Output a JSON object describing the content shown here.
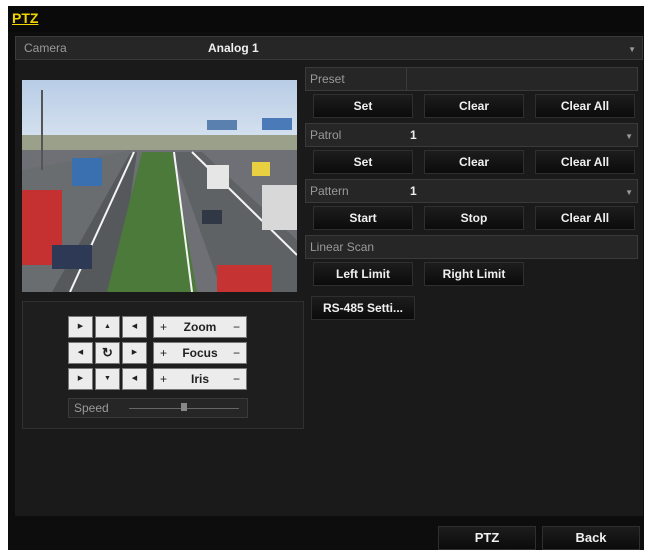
{
  "window": {
    "title": "PTZ"
  },
  "camera": {
    "label": "Camera",
    "value": "Analog 1"
  },
  "preset": {
    "label": "Preset",
    "value": "",
    "buttons": [
      "Set",
      "Clear",
      "Clear All"
    ]
  },
  "patrol": {
    "label": "Patrol",
    "value": "1",
    "buttons": [
      "Set",
      "Clear",
      "Clear All"
    ]
  },
  "pattern": {
    "label": "Pattern",
    "value": "1",
    "buttons": [
      "Start",
      "Stop",
      "Clear All"
    ]
  },
  "linear_scan": {
    "label": "Linear Scan",
    "buttons": [
      "Left Limit",
      "Right Limit"
    ]
  },
  "rs485": {
    "label": "RS-485 Setti..."
  },
  "controls": {
    "zoom": "Zoom",
    "focus": "Focus",
    "iris": "Iris",
    "plus": "+",
    "minus": "−",
    "speed_label": "Speed"
  },
  "footer": {
    "ptz": "PTZ",
    "back": "Back"
  },
  "colors": {
    "title": "#f2d500",
    "background": "#0d0d0d",
    "panel": "#1a1a1a"
  },
  "icons": [
    "chevron-down-icon",
    "arrow-icon",
    "refresh-icon"
  ]
}
